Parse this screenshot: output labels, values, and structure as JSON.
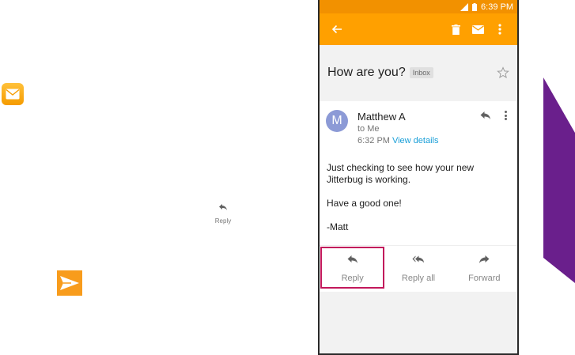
{
  "guide": {
    "app_icon": "mail-envelope-icon",
    "reply_label": "Reply",
    "send_icon": "send-arrow-icon"
  },
  "status_bar": {
    "time": "6:39 PM",
    "icons": [
      "signal-icon",
      "battery-icon"
    ]
  },
  "toolbar": {
    "icons": [
      "back-arrow-icon",
      "delete-icon",
      "mark-unread-icon",
      "more-vert-icon"
    ],
    "color": "#ffa000"
  },
  "email": {
    "subject": "How are you?",
    "label": "Inbox",
    "sender_initial": "M",
    "sender": "Matthew A",
    "recipient": "to Me",
    "time": "6:32 PM",
    "details_link": "View details",
    "body": [
      "Just checking to see how your new Jitterbug is working.",
      "Have a good one!",
      "-Matt"
    ]
  },
  "actions": [
    {
      "label": "Reply",
      "icon": "reply-icon"
    },
    {
      "label": "Reply all",
      "icon": "reply-all-icon"
    },
    {
      "label": "Forward",
      "icon": "forward-icon"
    }
  ],
  "colors": {
    "status_bar": "#f29100",
    "highlight": "#c2185b",
    "link": "#1a9fd8",
    "avatar": "#8c9ad6",
    "deco": "#6a1f8c"
  }
}
